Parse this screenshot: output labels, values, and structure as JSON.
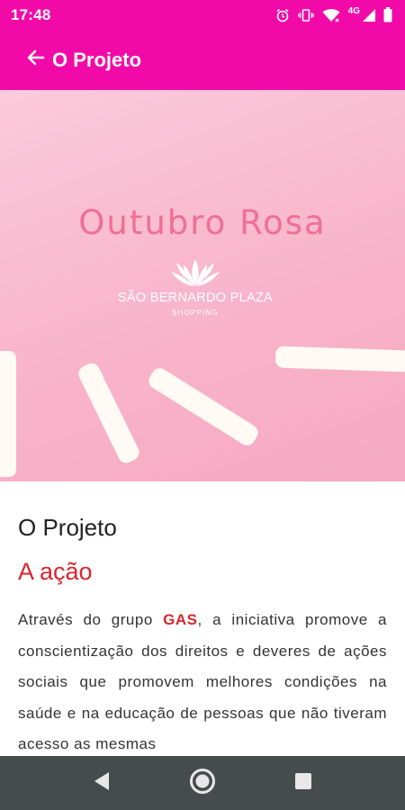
{
  "status_bar": {
    "time": "17:48",
    "network": "4G",
    "icons": [
      "alarm-icon",
      "vibrate-icon",
      "wifi-icon",
      "signal-icon",
      "battery-icon"
    ]
  },
  "app_bar": {
    "title": "O Projeto",
    "back_icon": "arrow-back-icon"
  },
  "banner": {
    "title": "Outubro Rosa",
    "logo_name": "SÃO BERNARDO PLAZA",
    "logo_sub": "SHOPPING"
  },
  "content": {
    "section_title": "O Projeto",
    "section_subtitle": "A ação",
    "body_before": "Através do grupo ",
    "body_highlight": "GAS",
    "body_after": ", a iniciativa promove a conscientização dos direitos e deveres de ações sociais que promovem melhores condições na saúde e na educação de pessoas que não tiveram acesso as mesmas"
  },
  "nav_bar": {
    "back": "nav-back-icon",
    "home": "nav-home-icon",
    "recents": "nav-recents-icon"
  },
  "colors": {
    "primary": "#f20aa8",
    "accent": "#d9262d",
    "banner_pink": "#f8b4cb",
    "nav_bg": "#464b4e"
  }
}
